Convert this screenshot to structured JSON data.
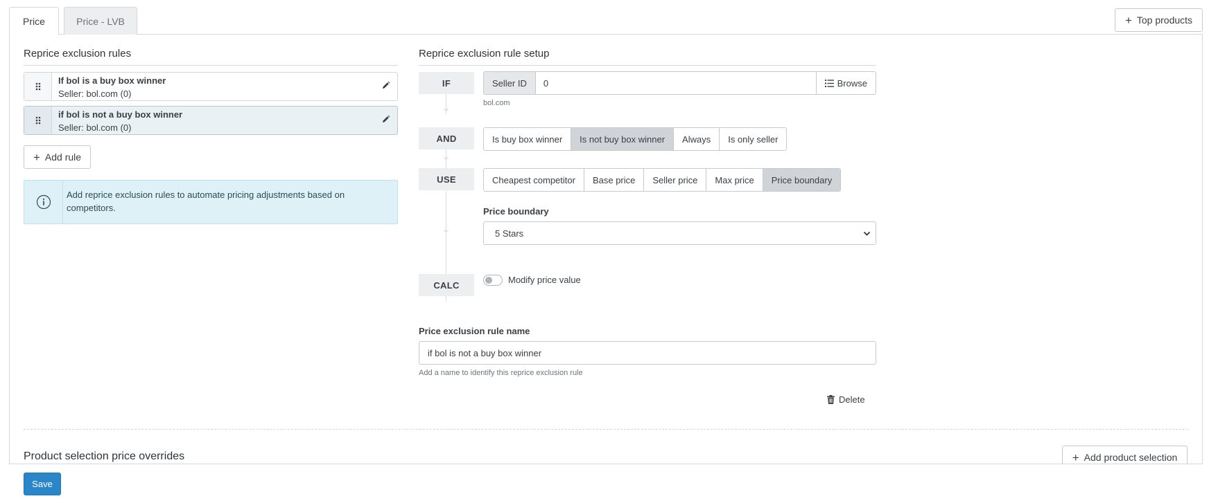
{
  "tabs": [
    {
      "label": "Price",
      "active": true
    },
    {
      "label": "Price - LVB",
      "active": false
    }
  ],
  "top_products_button": "Top products",
  "exclusion_rules": {
    "title": "Reprice exclusion rules",
    "rules": [
      {
        "title": "If bol is a buy box winner",
        "seller": "Seller: bol.com (0)",
        "selected": false
      },
      {
        "title": "if bol is not a buy box winner",
        "seller": "Seller: bol.com (0)",
        "selected": true
      }
    ],
    "add_rule_label": "Add rule",
    "info_text": "Add reprice exclusion rules to automate pricing adjustments based on competitors."
  },
  "setup": {
    "title": "Reprice exclusion rule setup",
    "if": {
      "label": "IF",
      "addon": "Seller ID",
      "value": "0",
      "browse_label": "Browse",
      "hint": "bol.com"
    },
    "and": {
      "label": "AND",
      "options": [
        "Is buy box winner",
        "Is not buy box winner",
        "Always",
        "Is only seller"
      ],
      "selected": "Is not buy box winner"
    },
    "use": {
      "label": "USE",
      "options": [
        "Cheapest competitor",
        "Base price",
        "Seller price",
        "Max price",
        "Price boundary"
      ],
      "selected": "Price boundary",
      "boundary_label": "Price boundary",
      "boundary_value": "5 Stars"
    },
    "calc": {
      "label": "CALC",
      "toggle_label": "Modify price value",
      "toggle_on": false
    },
    "name_label": "Price exclusion rule name",
    "name_value": "if bol is not a buy box winner",
    "name_hint": "Add a name to identify this reprice exclusion rule",
    "delete_label": "Delete"
  },
  "overrides": {
    "title": "Product selection price overrides",
    "add_label": "Add product selection"
  },
  "save_label": "Save",
  "colors": {
    "primary": "#2b86c9",
    "info_bg": "#ddf1f7",
    "segment_active": "#d0d4d8"
  }
}
